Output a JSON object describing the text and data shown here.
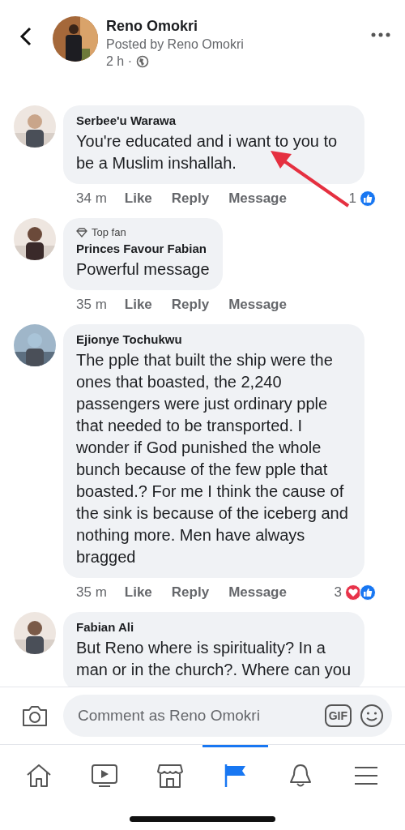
{
  "post": {
    "author": "Reno Omokri",
    "posted_by": "Posted by Reno Omokri",
    "time": "2 h ·"
  },
  "comments": [
    {
      "author": "Serbee'u Warawa",
      "text": "You're educated and i want to you to be a Muslim inshallah.",
      "time": "34 m",
      "actions": [
        "Like",
        "Reply",
        "Message"
      ],
      "reaction_count": "1",
      "reactions": [
        {
          "kind": "like"
        }
      ]
    },
    {
      "author": "Princes Favour Fabian",
      "badge": "Top fan",
      "text": "Powerful message",
      "time": "35 m",
      "actions": [
        "Like",
        "Reply",
        "Message"
      ]
    },
    {
      "author": "Ejionye Tochukwu",
      "text": "The pple that built the ship were the ones that boasted, the 2,240 passengers were just ordinary pple that needed to be transported. I wonder if God punished the whole bunch because of the few pple that boasted.? For me I think the cause of the sink is because of the iceberg and nothing more. Men have always bragged",
      "time": "35 m",
      "actions": [
        "Like",
        "Reply",
        "Message"
      ],
      "reaction_count": "3",
      "reactions": [
        {
          "kind": "love"
        },
        {
          "kind": "like"
        }
      ]
    },
    {
      "author": "Fabian Ali",
      "text": "But Reno where is spirituality? In a man or in the church?. Where can you"
    }
  ],
  "composer": {
    "placeholder": "Comment as Reno Omokri",
    "gif_label": "GIF"
  },
  "tabs": [
    {
      "kind": "home",
      "selected": false
    },
    {
      "kind": "video",
      "selected": false
    },
    {
      "kind": "marketplace",
      "selected": false
    },
    {
      "kind": "pages",
      "selected": true
    },
    {
      "kind": "notifications",
      "selected": false
    },
    {
      "kind": "menu",
      "selected": false
    }
  ]
}
